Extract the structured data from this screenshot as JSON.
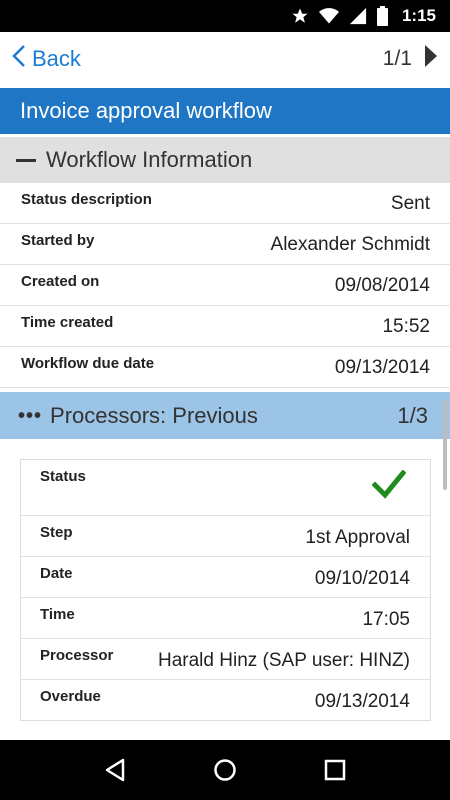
{
  "status_bar": {
    "time": "1:15",
    "icons": [
      "star-icon",
      "wifi-icon",
      "signal-icon",
      "battery-icon"
    ]
  },
  "nav": {
    "back_label": "Back",
    "pager": "1/1"
  },
  "title": "Invoice approval workflow",
  "workflow_section": {
    "heading": "Workflow Information",
    "rows": [
      {
        "label": "Status description",
        "value": "Sent"
      },
      {
        "label": "Started by",
        "value": "Alexander Schmidt"
      },
      {
        "label": "Created on",
        "value": "09/08/2014"
      },
      {
        "label": "Time created",
        "value": "15:52"
      },
      {
        "label": "Workflow due date",
        "value": "09/13/2014"
      }
    ]
  },
  "processors_section": {
    "heading": "Processors: Previous",
    "pager": "1/3",
    "status_label": "Status",
    "status_icon": "checkmark-icon",
    "status_color": "#1e8c1e",
    "rows": [
      {
        "label": "Step",
        "value": "1st Approval"
      },
      {
        "label": "Date",
        "value": "09/10/2014"
      },
      {
        "label": "Time",
        "value": "17:05"
      },
      {
        "label": "Processor",
        "value": "Harald Hinz (SAP user: HINZ)"
      },
      {
        "label": "Overdue",
        "value": "09/13/2014"
      }
    ]
  },
  "colors": {
    "accent": "#1e76c4",
    "link": "#1d7bd3",
    "section_gray": "#e0e0e0",
    "section_blue": "#9cc4e6"
  }
}
